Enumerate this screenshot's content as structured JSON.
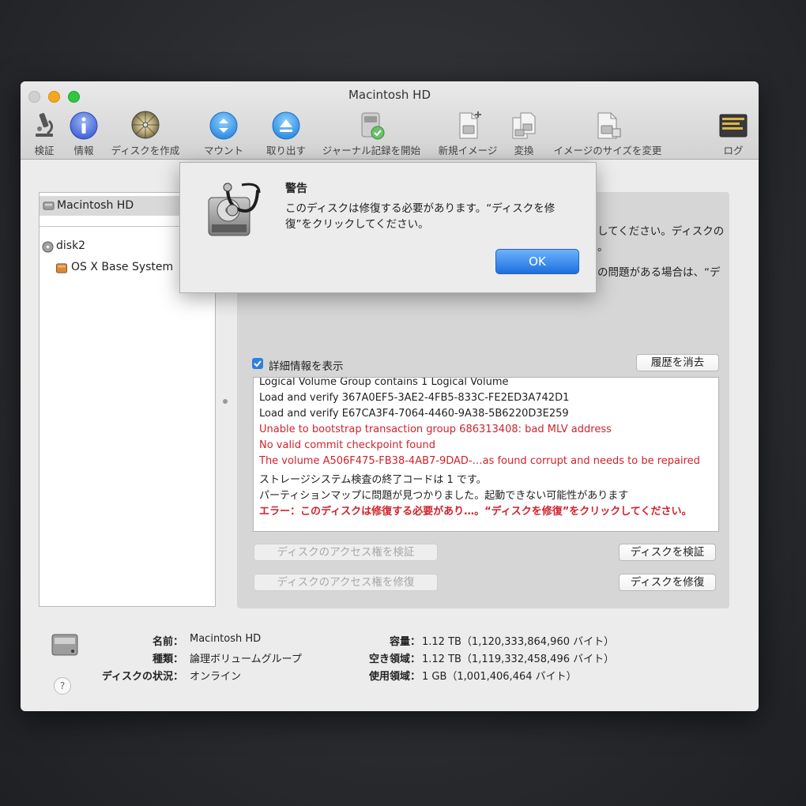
{
  "window": {
    "title": "Macintosh HD"
  },
  "toolbar": {
    "verify": "検証",
    "info": "情報",
    "create_disk": "ディスクを作成",
    "mount": "マウント",
    "eject": "取り出す",
    "journal": "ジャーナル記録を開始",
    "new_image": "新規イメージ",
    "convert": "変換",
    "resize_image": "イメージのサイズを変更",
    "log": "ログ"
  },
  "sidebar": {
    "selected": "Macintosh HD",
    "disk": "disk2",
    "volume": "OS X Base System"
  },
  "main": {
    "behind_line1": "してください。ディスクの",
    "behind_line2": "の問題がある場合は、“デ",
    "show_details": "詳細情報を表示",
    "clear_history": "履歴を消去",
    "verify_permissions": "ディスクのアクセス権を検証",
    "repair_permissions": "ディスクのアクセス権を修復",
    "verify_disk": "ディスクを検証",
    "repair_disk": "ディスクを修復"
  },
  "log": [
    {
      "text": "Logical Volume Group contains 1 Logical Volume",
      "style": "normal"
    },
    {
      "text": "Load and verify 367A0EF5-3AE2-4FB5-833C-FE2ED3A742D1",
      "style": "normal"
    },
    {
      "text": "Load and verify E67CA3F4-7064-4460-9A38-5B6220D3E259",
      "style": "normal"
    },
    {
      "text": "Unable to bootstrap transaction group 686313408: bad MLV address",
      "style": "red"
    },
    {
      "text": "No valid commit checkpoint found",
      "style": "red"
    },
    {
      "text": "The volume A506F475-FB38-4AB7-9DAD-…as found corrupt and needs to be repaired",
      "style": "red"
    },
    {
      "text": "ストレージシステム検査の終了コードは 1 です。",
      "style": "normal"
    },
    {
      "text": "パーティションマップに問題が見つかりました。起動できない可能性があります",
      "style": "normal"
    },
    {
      "text": "エラー：このディスクは修復する必要があり…。“ディスクを修復”をクリックしてください。",
      "style": "redb"
    }
  ],
  "info": {
    "name_label": "名前：",
    "name_value": "Macintosh HD",
    "type_label": "種類：",
    "type_value": "論理ボリュームグループ",
    "status_label": "ディスクの状況：",
    "status_value": "オンライン",
    "capacity_label": "容量：",
    "capacity_value": "1.12 TB（1,120,333,864,960 バイト）",
    "free_label": "空き領域：",
    "free_value": "1.12 TB（1,119,332,458,496 バイト）",
    "used_label": "使用領域：",
    "used_value": "1 GB（1,001,406,464 バイト）"
  },
  "dialog": {
    "title": "警告",
    "message": "このディスクは修復する必要があります。“ディスクを修復”をクリックしてください。",
    "ok": "OK"
  },
  "colors": {
    "accent": "#1d6fe0",
    "error": "#d0232c"
  },
  "icons": {
    "verify": "microscope-icon",
    "info": "info-icon",
    "create_disk": "disk-burn-icon",
    "mount": "mount-icon",
    "eject": "eject-icon",
    "journal": "journal-disk-icon",
    "new_image": "new-image-icon",
    "convert": "convert-icon",
    "resize_image": "resize-image-icon",
    "log": "log-console-icon",
    "dialog": "disk-utility-stethoscope-icon",
    "help": "help-icon"
  }
}
